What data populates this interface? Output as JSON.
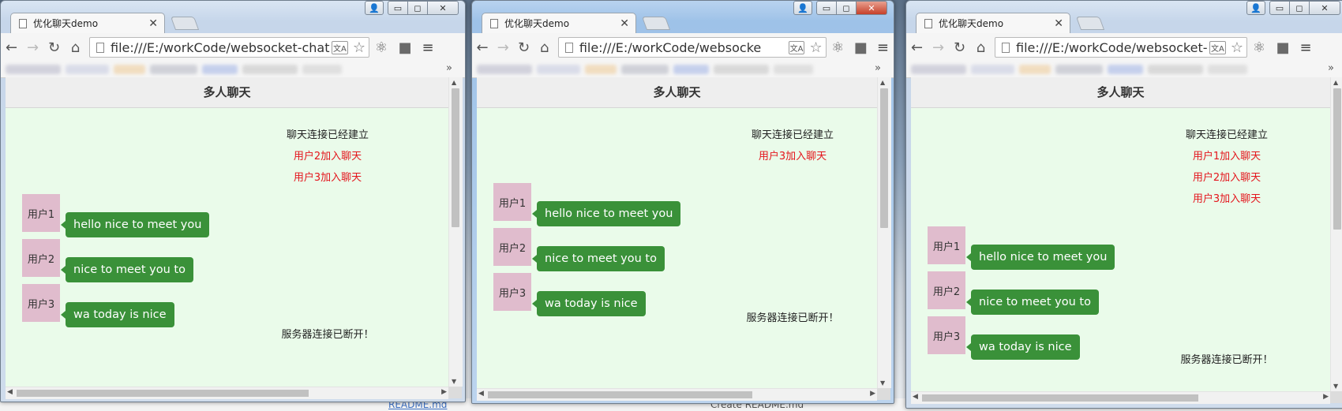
{
  "desktop": {
    "bottom_left_text": "README.md",
    "bottom_mid_text": "Create README.md"
  },
  "windows": [
    {
      "tab_title": "优化聊天demo",
      "url": "file:///E:/workCode/websocket-chatR",
      "header": "多人聊天",
      "system_messages": [
        {
          "text": "聊天连接已经建立",
          "color": "black"
        },
        {
          "text": "用户2加入聊天",
          "color": "red"
        },
        {
          "text": "用户3加入聊天",
          "color": "red"
        }
      ],
      "messages": [
        {
          "user": "用户1",
          "text": "hello nice to meet you"
        },
        {
          "user": "用户2",
          "text": "nice to meet you to"
        },
        {
          "user": "用户3",
          "text": "wa today is nice"
        }
      ],
      "footer_message": "服务器连接已断开！"
    },
    {
      "tab_title": "优化聊天demo",
      "url": "file:///E:/workCode/websocke",
      "header": "多人聊天",
      "system_messages": [
        {
          "text": "聊天连接已经建立",
          "color": "black"
        },
        {
          "text": "用户3加入聊天",
          "color": "red"
        }
      ],
      "messages": [
        {
          "user": "用户1",
          "text": "hello nice to meet you"
        },
        {
          "user": "用户2",
          "text": "nice to meet you to"
        },
        {
          "user": "用户3",
          "text": "wa today is nice"
        }
      ],
      "footer_message": "服务器连接已断开！"
    },
    {
      "tab_title": "优化聊天demo",
      "url": "file:///E:/workCode/websocket-c",
      "header": "多人聊天",
      "system_messages": [
        {
          "text": "聊天连接已经建立",
          "color": "black"
        },
        {
          "text": "用户1加入聊天",
          "color": "red"
        },
        {
          "text": "用户2加入聊天",
          "color": "red"
        },
        {
          "text": "用户3加入聊天",
          "color": "red"
        }
      ],
      "messages": [
        {
          "user": "用户1",
          "text": "hello nice to meet you"
        },
        {
          "user": "用户2",
          "text": "nice to meet you to"
        },
        {
          "user": "用户3",
          "text": "wa today is nice"
        }
      ],
      "footer_message": "服务器连接已断开！"
    }
  ],
  "colors": {
    "page_background": "#eafbea",
    "bubble": "#3a9139",
    "avatar": "#e0bccd",
    "join_message": "#e4151c"
  },
  "icons": {
    "back": "back-arrow-icon",
    "forward": "forward-arrow-icon",
    "reload": "reload-icon",
    "home": "home-icon",
    "bookmark_star": "star-icon",
    "translate": "translate-icon",
    "extension_react": "react-devtools-icon",
    "extension_dark": "extension-icon",
    "menu": "hamburger-menu-icon"
  }
}
